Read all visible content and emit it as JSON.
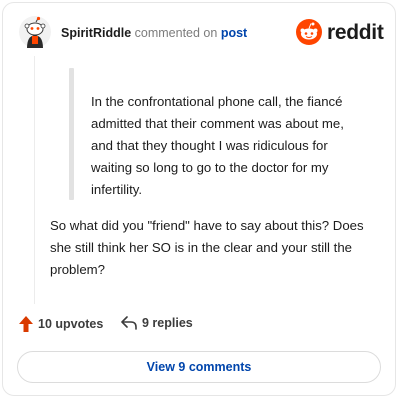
{
  "header": {
    "username": "SpiritRiddle",
    "action_text": "commented on",
    "post_link": "post",
    "brand": "reddit"
  },
  "comment": {
    "quote": "In the confrontational phone call, the fiancé admitted that their comment was about me, and that they thought I was ridiculous for waiting so long to go to the doctor for my infertility.",
    "body": "So what did you \"friend\" have to say about this? Does she still think her SO is in the clear and your still the problem?"
  },
  "actions": {
    "upvotes": "10 upvotes",
    "replies": "9 replies"
  },
  "footer": {
    "view_comments": "View 9 comments"
  },
  "colors": {
    "brand_orange": "#ff4500",
    "link_blue": "#0045ac",
    "upvote": "#d93a00"
  },
  "icons": [
    "avatar-snoo",
    "reddit-logo-icon",
    "upvote-arrow-icon",
    "reply-icon"
  ]
}
